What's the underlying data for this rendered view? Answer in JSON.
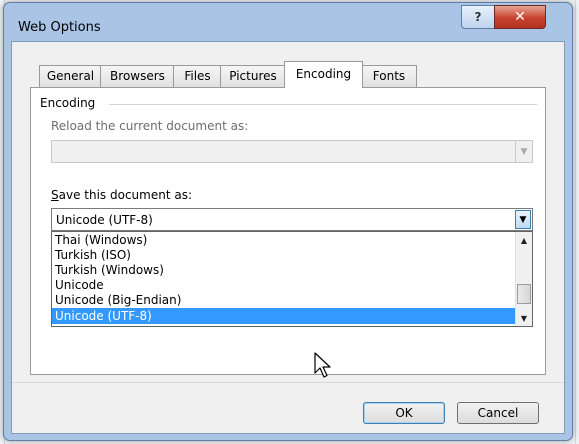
{
  "window": {
    "title": "Web Options",
    "help_glyph": "?",
    "close_glyph": "✕"
  },
  "tabs": [
    {
      "label": "General",
      "active": false
    },
    {
      "label": "Browsers",
      "active": false
    },
    {
      "label": "Files",
      "active": false
    },
    {
      "label": "Pictures",
      "active": false
    },
    {
      "label": "Encoding",
      "active": true
    },
    {
      "label": "Fonts",
      "active": false
    }
  ],
  "encoding": {
    "group_label": "Encoding",
    "reload_label": "Reload the current document as:",
    "reload_value": "",
    "save_label_mnemonic": "S",
    "save_label_rest": "ave this document as:",
    "save_value": "Unicode (UTF-8)",
    "options": [
      {
        "label": "Thai (Windows)",
        "selected": false
      },
      {
        "label": "Turkish (ISO)",
        "selected": false
      },
      {
        "label": "Turkish (Windows)",
        "selected": false
      },
      {
        "label": "Unicode",
        "selected": false
      },
      {
        "label": "Unicode (Big-Endian)",
        "selected": false
      },
      {
        "label": "Unicode (UTF-8)",
        "selected": true
      }
    ]
  },
  "buttons": {
    "ok": "OK",
    "cancel": "Cancel"
  },
  "colors": {
    "selection": "#3399ff",
    "close_button": "#c7432f",
    "title_bar": "#aac4e6"
  },
  "icons": {
    "dropdown_arrow": "▼",
    "scroll_up": "▲",
    "scroll_down": "▼",
    "cursor": "arrow-pointer-icon"
  }
}
